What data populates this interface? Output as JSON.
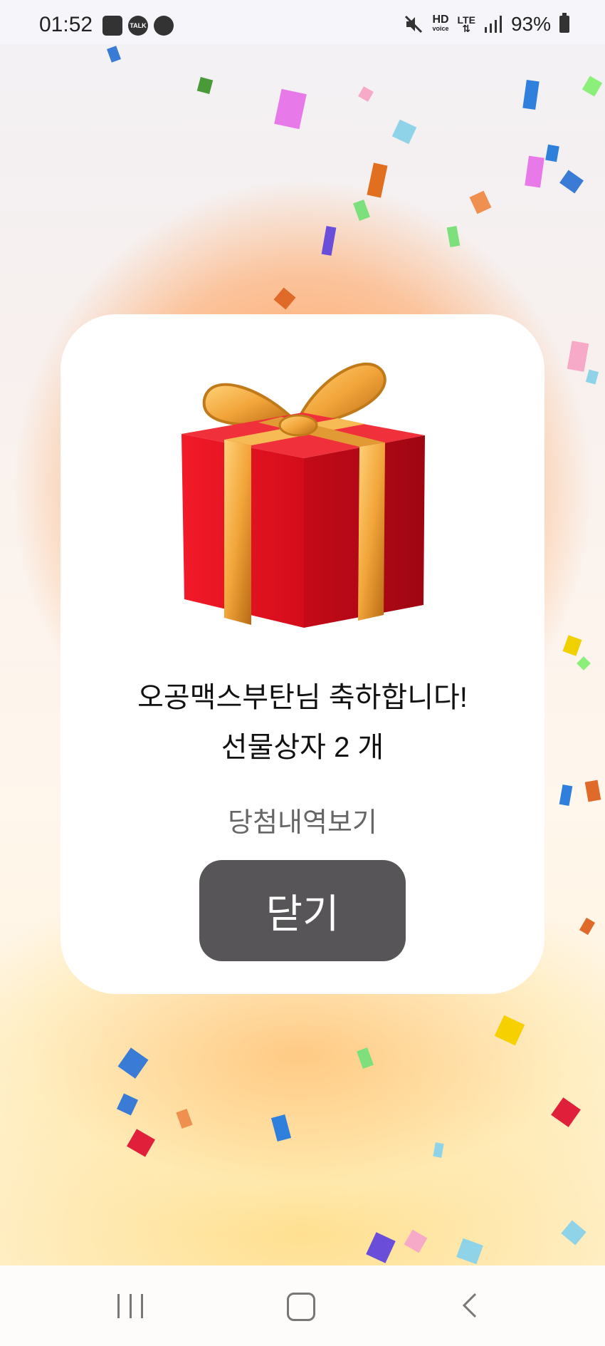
{
  "status_bar": {
    "time": "01:52",
    "notification_icons": [
      "gallery-icon",
      "kakaotalk-icon",
      "chat-bubble-icon"
    ],
    "talk_badge": "TALK",
    "hd_label": "HD",
    "voice_label": "voice",
    "lte_label": "LTE",
    "battery_percent": "93%",
    "system_icons": [
      "mute-icon",
      "hd-voice-icon",
      "lte-icon",
      "signal-icon",
      "battery-icon"
    ]
  },
  "dialog": {
    "gift_icon": "gift-box-icon",
    "message_line1": "오공맥스부탄님 축하합니다!",
    "message_line2": "선물상자 2 개",
    "history_link": "당첨내역보기",
    "close_button": "닫기"
  },
  "colors": {
    "card_bg": "#ffffff",
    "button_bg": "#575557",
    "button_text": "#ffffff",
    "link_text": "#666666",
    "gift_red": "#e0101e",
    "gift_ribbon": "#f2a53a"
  },
  "nav_bar": {
    "buttons": [
      "recent-apps-icon",
      "home-icon",
      "back-icon"
    ]
  }
}
